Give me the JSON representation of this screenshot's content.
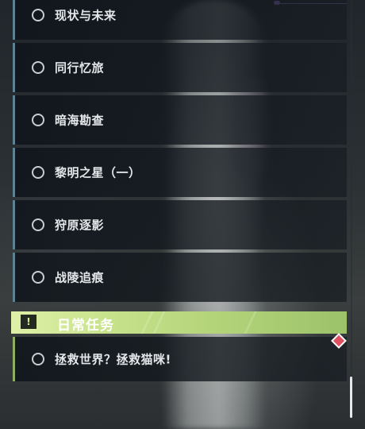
{
  "quests": [
    {
      "label": "现状与未来"
    },
    {
      "label": "同行忆旅"
    },
    {
      "label": "暗海勘查"
    },
    {
      "label": "黎明之星（一）"
    },
    {
      "label": "狩原逐影"
    },
    {
      "label": "战陵追痕"
    }
  ],
  "daily": {
    "title": "日常任务",
    "icon_glyph": "!",
    "icon": "quest-alert-icon",
    "items": [
      {
        "label": "拯救世界？拯救猫咪!"
      }
    ]
  },
  "colors": {
    "item_accent": "#5d8292",
    "daily_accent": "#8fae62",
    "daily_header": "#c6e28a",
    "tracker_marker": "#e05060"
  }
}
